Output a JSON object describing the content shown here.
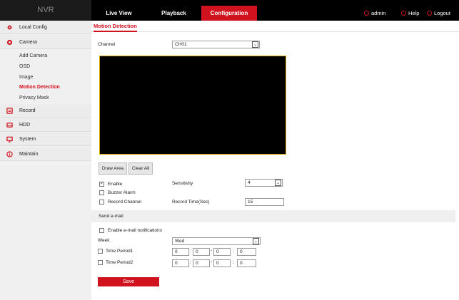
{
  "header": {
    "logo": "NVR",
    "tabs": [
      {
        "label": "Live View"
      },
      {
        "label": "Playback"
      },
      {
        "label": "Configuration"
      }
    ],
    "user": "admin",
    "help": "Help",
    "logout": "Logout",
    "accent": "#d0121f"
  },
  "sidebar": {
    "local_config": "Local Config",
    "camera": "Camera",
    "camera_sub": [
      "Add Camera",
      "OSD",
      "Image",
      "Motion Detection",
      "Privacy Mask"
    ],
    "record": "Record",
    "hdd": "HDD",
    "system": "System",
    "maintain": "Maintain"
  },
  "content": {
    "breadcrumb": "Motion Detection",
    "channel_label": "Channel",
    "channel_value": "CH01",
    "draw_area": "Draw Area",
    "clear_all": "Clear All",
    "enable": "Enable",
    "buzzer_alarm": "Buzzer Alarm",
    "record_channel": "Record Channel",
    "sensitivity_label": "Sensitivity",
    "sensitivity_value": "4",
    "record_time_label": "Record Time(Sec)",
    "record_time_value": "15",
    "send_email": "Send e-mail",
    "enable_email": "Enable e-mail notifications",
    "week_label": "Week",
    "week_value": "Wed",
    "time_period1": "Time Period1",
    "time_period2": "Time Period2",
    "time_zero": "0",
    "save": "Save"
  }
}
